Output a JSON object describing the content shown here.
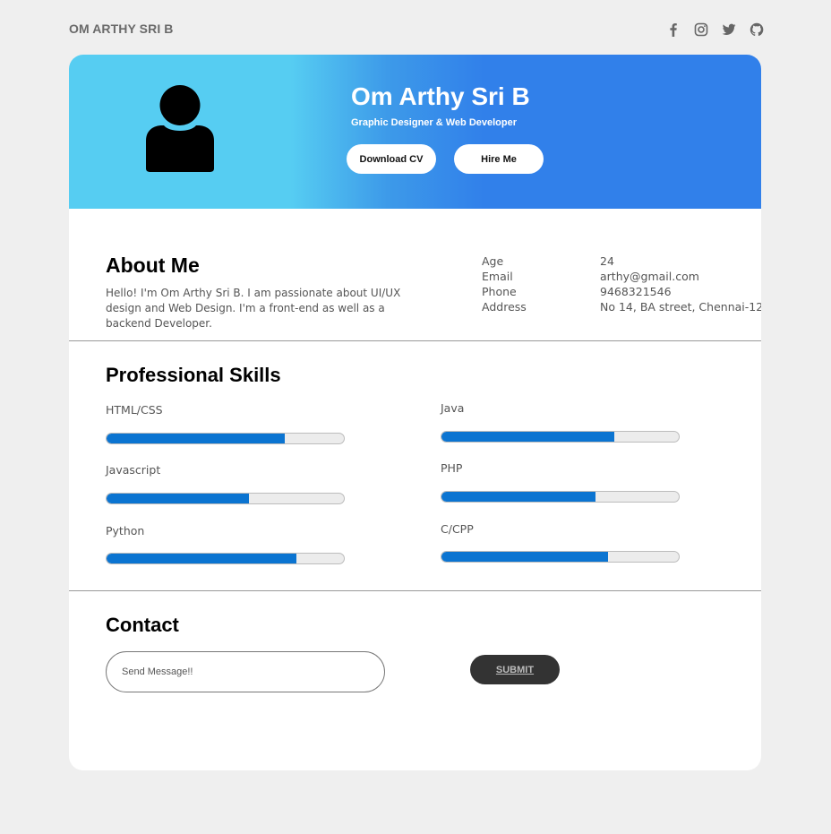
{
  "header": {
    "brand": "OM ARTHY SRI B",
    "socials": [
      {
        "icon": "facebook-icon"
      },
      {
        "icon": "instagram-icon"
      },
      {
        "icon": "twitter-icon"
      },
      {
        "icon": "github-icon"
      }
    ]
  },
  "hero": {
    "name": "Om Arthy Sri B",
    "role": "Graphic Designer & Web Developer",
    "download_label": "Download CV",
    "hire_label": "Hire Me",
    "avatar_icon": "user-avatar-icon"
  },
  "about": {
    "title": "About Me",
    "text": "Hello! I'm Om Arthy Sri B. I am passionate about UI/UX design and Web Design. I'm a front-end as well as a backend Developer.",
    "info": [
      {
        "label": "Age",
        "value": "24"
      },
      {
        "label": "Email",
        "value": "arthy@gmail.com"
      },
      {
        "label": "Phone",
        "value": "9468321546"
      },
      {
        "label": "Address",
        "value": "No 14, BA street, Chennai-12"
      }
    ]
  },
  "skills": {
    "title": "Professional Skills",
    "items": [
      {
        "name": "HTML/CSS",
        "level": 0.75
      },
      {
        "name": "Javascript",
        "level": 0.6
      },
      {
        "name": "Python",
        "level": 0.8
      },
      {
        "name": "Java",
        "level": 0.73
      },
      {
        "name": "PHP",
        "level": 0.65
      },
      {
        "name": "C/CPP",
        "level": 0.7
      }
    ]
  },
  "contact": {
    "title": "Contact",
    "placeholder": "Send Message!!",
    "submit_label": "SUBMIT"
  },
  "colors": {
    "accent": "#3180ea",
    "accent_light": "#56cdf2",
    "bar_fill": "#0b74d1",
    "submit_bg": "#333333"
  }
}
